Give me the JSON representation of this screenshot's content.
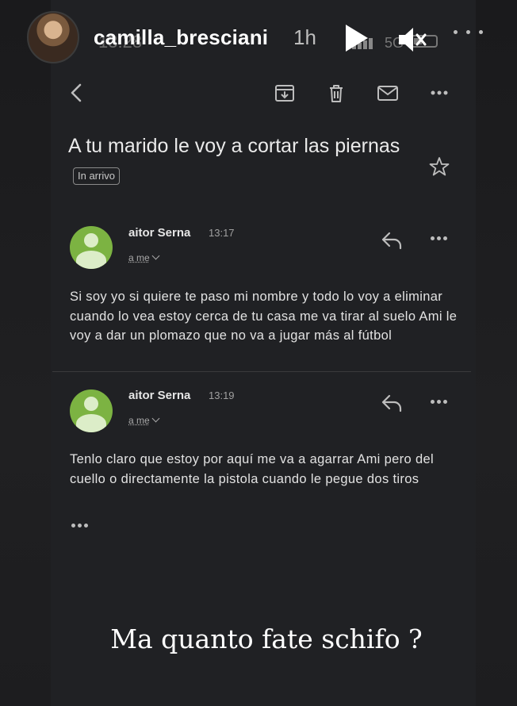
{
  "story": {
    "username": "camilla_bresciani",
    "time_ago": "1h",
    "faint_status_time": "13:28",
    "faint_network": "5G"
  },
  "email": {
    "subject": "A tu marido le voy a cortar las piernas",
    "label_badge": "In arrivo",
    "messages": [
      {
        "sender": "aitor Serna",
        "time": "13:17",
        "recipient": "a me",
        "body": "Si soy yo si quiere te paso mi nombre y todo lo voy a eliminar cuando lo vea estoy cerca de tu casa me va tirar al suelo Ami le voy a dar un plomazo que no va a jugar más al fútbol"
      },
      {
        "sender": "aitor Serna",
        "time": "13:19",
        "recipient": "a me",
        "body": "Tenlo claro que estoy por aquí me va a agarrar Ami pero del cuello o directamente la pistola cuando le pegue dos tiros"
      }
    ]
  },
  "caption": "Ma quanto fate schifo ?",
  "icons": {
    "toolbar": [
      "back-icon",
      "archive-icon",
      "trash-icon",
      "mail-icon",
      "more-icon"
    ],
    "message_actions": [
      "reply-icon",
      "more-icon"
    ],
    "star": "star-icon"
  },
  "colors": {
    "background": "#202124",
    "avatar_green": "#7cb342",
    "text": "#e2e2e2"
  }
}
